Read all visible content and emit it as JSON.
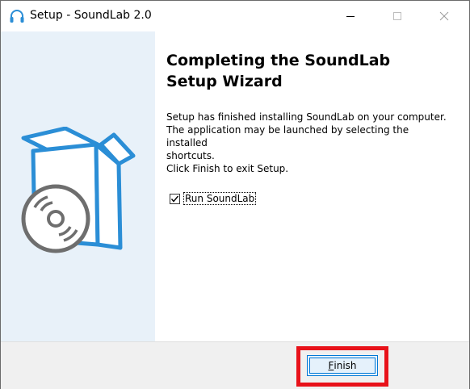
{
  "window": {
    "title": "Setup - SoundLab 2.0",
    "icon": "headphones-icon"
  },
  "title_controls": {
    "minimize_icon": "minimize-icon",
    "maximize_icon": "maximize-icon",
    "close_icon": "close-icon"
  },
  "wizard": {
    "heading_line1": "Completing the SoundLab",
    "heading_line2": "Setup Wizard",
    "body_line1": "Setup has finished installing SoundLab on your computer.",
    "body_line2": "The application may be launched by selecting the installed",
    "body_line3": "shortcuts.",
    "exit_instruction": "Click Finish to exit Setup.",
    "run_checkbox_label": "Run SoundLab",
    "run_checkbox_checked": true,
    "illustration": "software-box-with-disc-icon"
  },
  "footer": {
    "finish_mnemonic": "F",
    "finish_rest": "inish"
  },
  "colors": {
    "accent": "#0078d7",
    "illustration_blue": "#2b8ed6",
    "left_panel_bg": "#e8f1f9",
    "highlight": "#e8121a",
    "footer_bg": "#f0f0f0"
  }
}
